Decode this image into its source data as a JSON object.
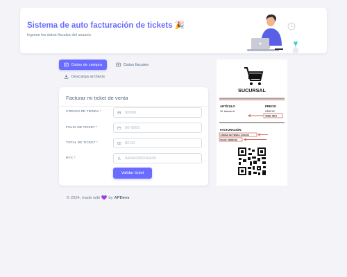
{
  "header": {
    "title": "Sistema de auto facturación de tickets 🎉",
    "subtitle": "Ingrese los datos fiscales del usuario."
  },
  "tabs": [
    {
      "label": "Datos de compra",
      "icon": "receipt-icon",
      "active": true
    },
    {
      "label": "Datos fiscales",
      "icon": "id-card-icon",
      "active": false
    },
    {
      "label": "Descarga archivos",
      "icon": "download-icon",
      "active": false
    }
  ],
  "form": {
    "title": "Facturar mi ticket de venta",
    "fields": [
      {
        "label": "CÓDIGO DE TIENDA",
        "required": "*",
        "placeholder": "00000",
        "icon": "store-icon"
      },
      {
        "label": "FOLIO DE TICKET",
        "required": "*",
        "placeholder": "00-0000",
        "icon": "calendar-icon"
      },
      {
        "label": "TOTAL DE TICKET",
        "required": "*",
        "placeholder": "$0.00",
        "icon": "money-icon"
      },
      {
        "label": "RFC",
        "required": "*",
        "placeholder": "AAAA000000A00",
        "icon": "user-icon"
      }
    ],
    "submit_label": "Validar ticket"
  },
  "ticket": {
    "store": "SUCURSAL",
    "col_article": "ARTÍCULO",
    "col_price": "PRECIO",
    "item_name": "10. Artículo A",
    "item_price": "GRATIS*",
    "total": "Total: $0.0",
    "section": "FACTURACIÓN",
    "store_code": "CÓDIGO DE TIENDA: XXXXXX",
    "folio": "FOLIO: 000000-00"
  },
  "footer": {
    "prefix": "© 2024, made with",
    "by": "by",
    "brand": "APDevs"
  },
  "colors": {
    "accent": "#696cff",
    "alert": "#ff3e1d"
  }
}
